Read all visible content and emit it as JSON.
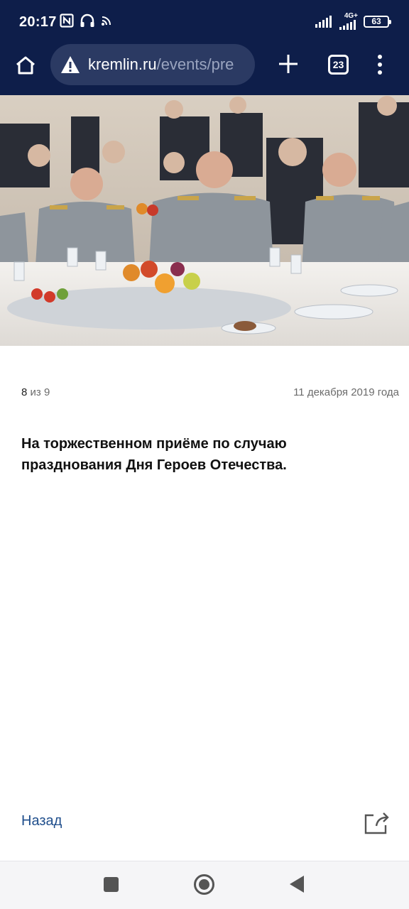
{
  "status_bar": {
    "time": "20:17",
    "network": "4G+",
    "battery": "63"
  },
  "browser": {
    "url_host": "kremlin.ru",
    "url_path": "/events/pre",
    "tab_count": "23"
  },
  "gallery": {
    "current": "8",
    "of_word": "из",
    "total": "9",
    "date": "11 декабря 2019 года",
    "caption": "На торжественном приёме по случаю празднования Дня Героев Отечества."
  },
  "footer": {
    "back_label": "Назад"
  },
  "colors": {
    "top_bar": "#0e1e4a",
    "url_bar": "#2b3a63",
    "link": "#1f4e8c"
  }
}
